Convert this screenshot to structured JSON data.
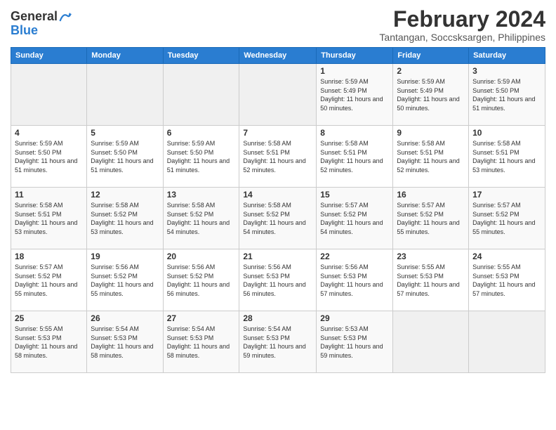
{
  "logo": {
    "line1": "General",
    "line2": "Blue"
  },
  "title": "February 2024",
  "location": "Tantangan, Soccsksargen, Philippines",
  "days_of_week": [
    "Sunday",
    "Monday",
    "Tuesday",
    "Wednesday",
    "Thursday",
    "Friday",
    "Saturday"
  ],
  "weeks": [
    [
      {
        "day": "",
        "info": ""
      },
      {
        "day": "",
        "info": ""
      },
      {
        "day": "",
        "info": ""
      },
      {
        "day": "",
        "info": ""
      },
      {
        "day": "1",
        "info": "Sunrise: 5:59 AM\nSunset: 5:49 PM\nDaylight: 11 hours and 50 minutes."
      },
      {
        "day": "2",
        "info": "Sunrise: 5:59 AM\nSunset: 5:49 PM\nDaylight: 11 hours and 50 minutes."
      },
      {
        "day": "3",
        "info": "Sunrise: 5:59 AM\nSunset: 5:50 PM\nDaylight: 11 hours and 51 minutes."
      }
    ],
    [
      {
        "day": "4",
        "info": "Sunrise: 5:59 AM\nSunset: 5:50 PM\nDaylight: 11 hours and 51 minutes."
      },
      {
        "day": "5",
        "info": "Sunrise: 5:59 AM\nSunset: 5:50 PM\nDaylight: 11 hours and 51 minutes."
      },
      {
        "day": "6",
        "info": "Sunrise: 5:59 AM\nSunset: 5:50 PM\nDaylight: 11 hours and 51 minutes."
      },
      {
        "day": "7",
        "info": "Sunrise: 5:58 AM\nSunset: 5:51 PM\nDaylight: 11 hours and 52 minutes."
      },
      {
        "day": "8",
        "info": "Sunrise: 5:58 AM\nSunset: 5:51 PM\nDaylight: 11 hours and 52 minutes."
      },
      {
        "day": "9",
        "info": "Sunrise: 5:58 AM\nSunset: 5:51 PM\nDaylight: 11 hours and 52 minutes."
      },
      {
        "day": "10",
        "info": "Sunrise: 5:58 AM\nSunset: 5:51 PM\nDaylight: 11 hours and 53 minutes."
      }
    ],
    [
      {
        "day": "11",
        "info": "Sunrise: 5:58 AM\nSunset: 5:51 PM\nDaylight: 11 hours and 53 minutes."
      },
      {
        "day": "12",
        "info": "Sunrise: 5:58 AM\nSunset: 5:52 PM\nDaylight: 11 hours and 53 minutes."
      },
      {
        "day": "13",
        "info": "Sunrise: 5:58 AM\nSunset: 5:52 PM\nDaylight: 11 hours and 54 minutes."
      },
      {
        "day": "14",
        "info": "Sunrise: 5:58 AM\nSunset: 5:52 PM\nDaylight: 11 hours and 54 minutes."
      },
      {
        "day": "15",
        "info": "Sunrise: 5:57 AM\nSunset: 5:52 PM\nDaylight: 11 hours and 54 minutes."
      },
      {
        "day": "16",
        "info": "Sunrise: 5:57 AM\nSunset: 5:52 PM\nDaylight: 11 hours and 55 minutes."
      },
      {
        "day": "17",
        "info": "Sunrise: 5:57 AM\nSunset: 5:52 PM\nDaylight: 11 hours and 55 minutes."
      }
    ],
    [
      {
        "day": "18",
        "info": "Sunrise: 5:57 AM\nSunset: 5:52 PM\nDaylight: 11 hours and 55 minutes."
      },
      {
        "day": "19",
        "info": "Sunrise: 5:56 AM\nSunset: 5:52 PM\nDaylight: 11 hours and 55 minutes."
      },
      {
        "day": "20",
        "info": "Sunrise: 5:56 AM\nSunset: 5:52 PM\nDaylight: 11 hours and 56 minutes."
      },
      {
        "day": "21",
        "info": "Sunrise: 5:56 AM\nSunset: 5:53 PM\nDaylight: 11 hours and 56 minutes."
      },
      {
        "day": "22",
        "info": "Sunrise: 5:56 AM\nSunset: 5:53 PM\nDaylight: 11 hours and 57 minutes."
      },
      {
        "day": "23",
        "info": "Sunrise: 5:55 AM\nSunset: 5:53 PM\nDaylight: 11 hours and 57 minutes."
      },
      {
        "day": "24",
        "info": "Sunrise: 5:55 AM\nSunset: 5:53 PM\nDaylight: 11 hours and 57 minutes."
      }
    ],
    [
      {
        "day": "25",
        "info": "Sunrise: 5:55 AM\nSunset: 5:53 PM\nDaylight: 11 hours and 58 minutes."
      },
      {
        "day": "26",
        "info": "Sunrise: 5:54 AM\nSunset: 5:53 PM\nDaylight: 11 hours and 58 minutes."
      },
      {
        "day": "27",
        "info": "Sunrise: 5:54 AM\nSunset: 5:53 PM\nDaylight: 11 hours and 58 minutes."
      },
      {
        "day": "28",
        "info": "Sunrise: 5:54 AM\nSunset: 5:53 PM\nDaylight: 11 hours and 59 minutes."
      },
      {
        "day": "29",
        "info": "Sunrise: 5:53 AM\nSunset: 5:53 PM\nDaylight: 11 hours and 59 minutes."
      },
      {
        "day": "",
        "info": ""
      },
      {
        "day": "",
        "info": ""
      }
    ]
  ]
}
